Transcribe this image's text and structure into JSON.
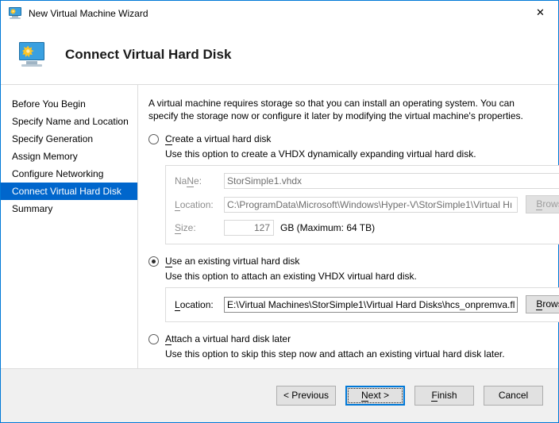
{
  "window": {
    "title": "New Virtual Machine Wizard",
    "title_icon": "virtual-machine-icon",
    "close_label": "✕",
    "accent_color": "#0078d7"
  },
  "header": {
    "title": "Connect Virtual Hard Disk",
    "icon": "virtual-machine-icon"
  },
  "sidebar": {
    "items": [
      {
        "label": "Before You Begin",
        "selected": false
      },
      {
        "label": "Specify Name and Location",
        "selected": false
      },
      {
        "label": "Specify Generation",
        "selected": false
      },
      {
        "label": "Assign Memory",
        "selected": false
      },
      {
        "label": "Configure Networking",
        "selected": false
      },
      {
        "label": "Connect Virtual Hard Disk",
        "selected": true
      },
      {
        "label": "Summary",
        "selected": false
      }
    ],
    "selected_bg": "#0066cc",
    "selected_fg": "#ffffff"
  },
  "content": {
    "intro": "A virtual machine requires storage so that you can install an operating system. You can specify the storage now or configure it later by modifying the virtual machine's properties.",
    "option_create": {
      "label": "Create a virtual hard disk",
      "accel": "C",
      "label_rest": "reate a virtual hard disk",
      "selected": false,
      "description": "Use this option to create a VHDX dynamically expanding virtual hard disk.",
      "enabled": false,
      "fields": {
        "name_label_accel": "N",
        "name_label_pre": "Na",
        "name_label_post": "e:",
        "name_label": "Name:",
        "name_value": "StorSimple1.vhdx",
        "location_label": "Location:",
        "location_label_accel": "L",
        "location_label_post": "ocation:",
        "location_value": "C:\\ProgramData\\Microsoft\\Windows\\Hyper-V\\StorSimple1\\Virtual Hı",
        "location_browse": "Browse...",
        "location_browse_accel": "B",
        "location_browse_post": "rowse...",
        "size_label": "Size:",
        "size_label_accel": "S",
        "size_label_post": "ize:",
        "size_value": "127",
        "size_units": "GB (Maximum: 64 TB)"
      }
    },
    "option_existing": {
      "label": "Use an existing virtual hard disk",
      "accel": "U",
      "label_rest": "se an existing virtual hard disk",
      "selected": true,
      "description": "Use this option to attach an existing VHDX virtual hard disk.",
      "location_label": "Location:",
      "location_label_accel": "L",
      "location_label_post": "ocation:",
      "location_value": "E:\\Virtual Machines\\StorSimple1\\Virtual Hard Disks\\hcs_onpremva.fl",
      "browse_label": "Browse...",
      "browse_accel": "B",
      "browse_post": "rowse..."
    },
    "option_later": {
      "label": "Attach a virtual hard disk later",
      "accel": "A",
      "label_rest": "ttach a virtual hard disk later",
      "selected": false,
      "description": "Use this option to skip this step now and attach an existing virtual hard disk later."
    }
  },
  "footer": {
    "previous": "< Previous",
    "previous_pre": "< P",
    "previous_accel": "P",
    "previous_post": "revious",
    "next": "Next >",
    "next_accel": "N",
    "next_post": "ext >",
    "finish": "Finish",
    "finish_accel": "F",
    "finish_post": "inish",
    "cancel": "Cancel",
    "default_button": "Next >"
  }
}
